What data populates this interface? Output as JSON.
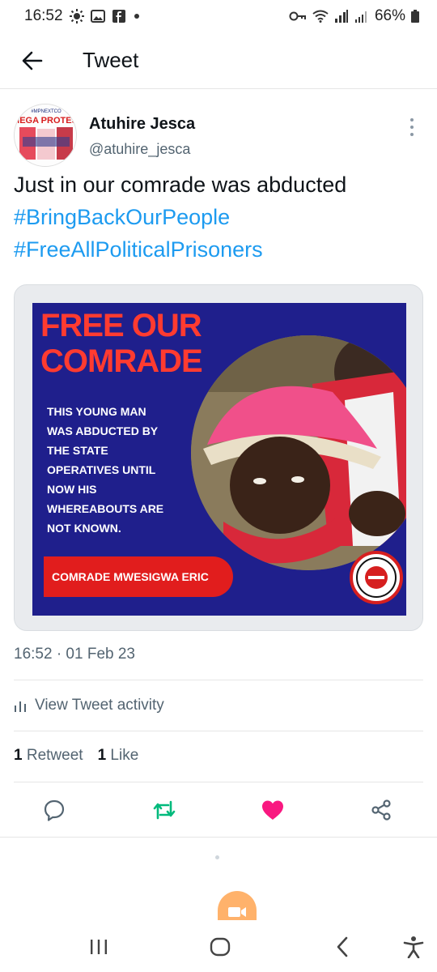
{
  "status_bar": {
    "time": "16:52",
    "battery": "66%"
  },
  "header": {
    "title": "Tweet"
  },
  "tweet": {
    "author_name": "Atuhire Jesca",
    "author_handle": "@atuhire_jesca",
    "avatar_text": [
      "#MPNEXTCO",
      "MEGA PROTES."
    ],
    "text": "Just in our comrade was abducted",
    "hashtags": [
      "#BringBackOurPeople",
      "#FreeAllPoliticalPrisoners"
    ],
    "timestamp": "16:52 · 01 Feb 23"
  },
  "media": {
    "poster_title": [
      "FREE OUR",
      "COMRADE"
    ],
    "poster_body": [
      "THIS YOUNG MAN",
      "WAS ABDUCTED BY",
      "THE STATE",
      "OPERATIVES UNTIL",
      "NOW HIS",
      "WHEREABOUTS ARE",
      "NOT KNOWN."
    ],
    "poster_banner": "COMRADE MWESIGWA ERIC",
    "background_color": "#1f1f8c",
    "title_color": "#ff3b30"
  },
  "activity": {
    "label": "View Tweet activity"
  },
  "stats": {
    "retweet_count": "1",
    "retweet_label": "Retweet",
    "like_count": "1",
    "like_label": "Like"
  },
  "actions": {
    "reply_icon": "reply-icon",
    "retweet_icon": "retweet-icon",
    "like_icon": "heart-icon",
    "share_icon": "share-icon",
    "retweet_color": "#00ba7c",
    "like_color": "#f91880"
  }
}
